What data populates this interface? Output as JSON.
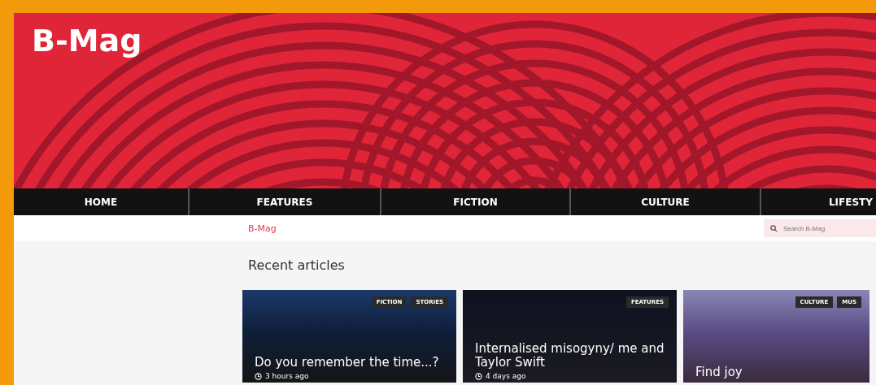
{
  "site": {
    "logo": "B-Mag"
  },
  "nav": [
    {
      "label": "HOME"
    },
    {
      "label": "FEATURES"
    },
    {
      "label": "FICTION"
    },
    {
      "label": "CULTURE"
    },
    {
      "label": "LIFESTY"
    }
  ],
  "breadcrumb": "B-Mag",
  "search": {
    "placeholder": "Search B-Mag"
  },
  "section_title": "Recent articles",
  "articles": [
    {
      "title": "Do you remember the time...?",
      "tags": [
        "FICTION",
        "STORIES"
      ],
      "time": "3 hours ago"
    },
    {
      "title": "Internalised misogyny/ me and Taylor Swift",
      "tags": [
        "FEATURES"
      ],
      "time": "4 days ago"
    },
    {
      "title": "Find joy",
      "tags": [
        "CULTURE",
        "MUS"
      ]
    }
  ]
}
